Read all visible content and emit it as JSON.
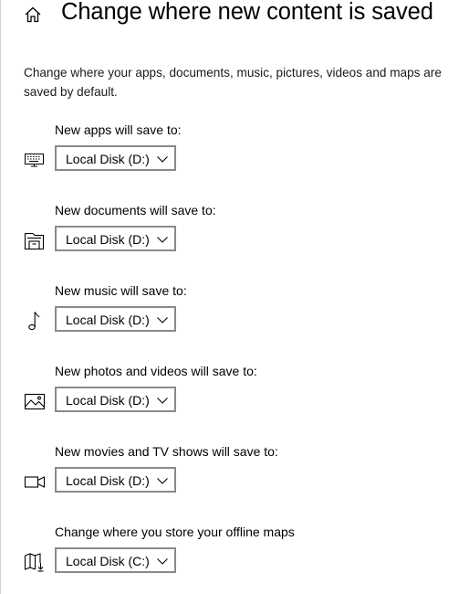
{
  "header": {
    "title": "Change where new content is saved",
    "home_icon": "home-icon"
  },
  "description": "Change where your apps, documents, music, pictures, videos and maps are saved by default.",
  "settings": [
    {
      "label": "New apps will save to:",
      "value": "Local Disk (D:)",
      "icon": "keyboard-icon"
    },
    {
      "label": "New documents will save to:",
      "value": "Local Disk (D:)",
      "icon": "document-drawer-icon"
    },
    {
      "label": "New music will save to:",
      "value": "Local Disk (D:)",
      "icon": "music-note-icon"
    },
    {
      "label": "New photos and videos will save to:",
      "value": "Local Disk (D:)",
      "icon": "photo-icon"
    },
    {
      "label": "New movies and TV shows will save to:",
      "value": "Local Disk (D:)",
      "icon": "video-camera-icon"
    },
    {
      "label": "Change where you store your offline maps",
      "value": "Local Disk (C:)",
      "icon": "map-download-icon"
    }
  ],
  "colors": {
    "text": "#000000",
    "dropdown_border": "#8a8a8a",
    "background": "#ffffff"
  }
}
